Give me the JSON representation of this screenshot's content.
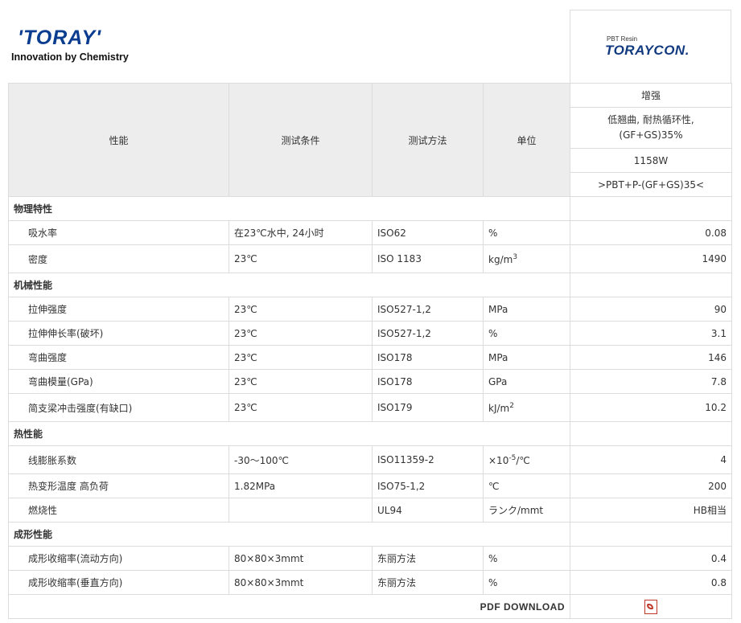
{
  "header": {
    "logo_text": "'TORAY'",
    "tagline": "Innovation by Chemistry",
    "brand_small": "PBT Resin",
    "brand_name": "TORAYCON."
  },
  "columns": {
    "property": "性能",
    "condition": "测试条件",
    "method": "测试方法",
    "unit": "单位"
  },
  "product": {
    "grade_type": "增强",
    "feature": "低翘曲, 耐热循环性, (GF+GS)35%",
    "grade": "1158W",
    "composition": ">PBT+P-(GF+GS)35<"
  },
  "sections": [
    {
      "title": "物理特性",
      "rows": [
        {
          "name": "吸水率",
          "condition": "在23℃水中, 24小时",
          "method": "ISO62",
          "unit": "%",
          "unit_sup": "",
          "unit_tail": "",
          "value": "0.08"
        },
        {
          "name": "密度",
          "condition": "23℃",
          "method": "ISO 1183",
          "unit": "kg/m",
          "unit_sup": "3",
          "unit_tail": "",
          "value": "1490"
        }
      ]
    },
    {
      "title": "机械性能",
      "rows": [
        {
          "name": "拉伸强度",
          "condition": "23℃",
          "method": "ISO527-1,2",
          "unit": "MPa",
          "unit_sup": "",
          "unit_tail": "",
          "value": "90"
        },
        {
          "name": "拉伸伸长率(破坏)",
          "condition": "23℃",
          "method": "ISO527-1,2",
          "unit": "%",
          "unit_sup": "",
          "unit_tail": "",
          "value": "3.1"
        },
        {
          "name": "弯曲强度",
          "condition": "23℃",
          "method": "ISO178",
          "unit": "MPa",
          "unit_sup": "",
          "unit_tail": "",
          "value": "146"
        },
        {
          "name": "弯曲模量(GPa)",
          "condition": "23℃",
          "method": "ISO178",
          "unit": "GPa",
          "unit_sup": "",
          "unit_tail": "",
          "value": "7.8"
        },
        {
          "name": "简支梁冲击强度(有缺口)",
          "condition": "23℃",
          "method": "ISO179",
          "unit": "kJ/m",
          "unit_sup": "2",
          "unit_tail": "",
          "value": "10.2"
        }
      ]
    },
    {
      "title": "热性能",
      "rows": [
        {
          "name": "线膨胀系数",
          "condition": "-30～100℃",
          "method": "ISO11359-2",
          "unit": "×10",
          "unit_sup": "-5",
          "unit_tail": "/℃",
          "value": "4"
        },
        {
          "name": "热变形温度 高负荷",
          "condition": "1.82MPa",
          "method": "ISO75-1,2",
          "unit": "℃",
          "unit_sup": "",
          "unit_tail": "",
          "value": "200"
        },
        {
          "name": "燃烧性",
          "condition": "",
          "method": "UL94",
          "unit": "ランク/mmt",
          "unit_sup": "",
          "unit_tail": "",
          "value": "HB相当"
        }
      ]
    },
    {
      "title": "成形性能",
      "rows": [
        {
          "name": "成形收缩率(流动方向)",
          "condition": "80×80×3mmt",
          "method": "东丽方法",
          "unit": "%",
          "unit_sup": "",
          "unit_tail": "",
          "value": "0.4"
        },
        {
          "name": "成形收缩率(垂直方向)",
          "condition": "80×80×3mmt",
          "method": "东丽方法",
          "unit": "%",
          "unit_sup": "",
          "unit_tail": "",
          "value": "0.8"
        }
      ]
    }
  ],
  "footer": {
    "download_label": "PDF DOWNLOAD",
    "download_icon": "pdf-icon"
  }
}
